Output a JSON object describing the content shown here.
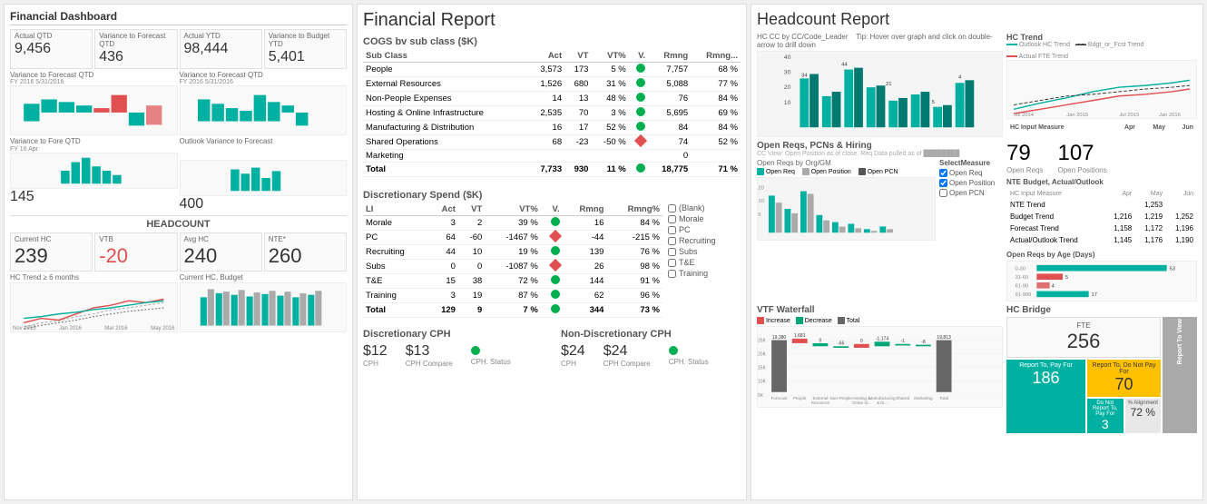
{
  "panel1": {
    "title": "Financial Dashboard",
    "kpis": [
      {
        "label": "Actual QTD",
        "value": "9,456"
      },
      {
        "label": "Variance to Forecast QTD",
        "value": "436"
      },
      {
        "label": "Actual YTD",
        "value": "98,444"
      },
      {
        "label": "Variance to Budget YTD",
        "value": "5,401"
      }
    ],
    "headcount_title": "HEADCOUNT",
    "hc_kpis": [
      {
        "label": "Current HC",
        "value": "239"
      },
      {
        "label": "VTB",
        "value": "-20"
      },
      {
        "label": "Avg HC",
        "value": "240"
      },
      {
        "label": "NTE*",
        "value": "260"
      }
    ],
    "variance_labels": [
      "Variance to Fore QTD",
      "Variance to Forecast QTD",
      "Outlook Variance to Forecast"
    ],
    "variance_values": [
      "145",
      "",
      "400"
    ]
  },
  "panel2": {
    "title": "Financial Report",
    "cogs_title": "COGS bv sub class ($K)",
    "columns": [
      "Sub Class",
      "Act",
      "VT",
      "VT%",
      "V.",
      "Rmng",
      "Rmng..."
    ],
    "rows": [
      {
        "name": "People",
        "act": "3,573",
        "vt": "173",
        "vt_pct": "5 %",
        "dot": "green",
        "rmng": "7,757",
        "rmng_pct": "68 %"
      },
      {
        "name": "External Resources",
        "act": "1,526",
        "vt": "680",
        "vt_pct": "31 %",
        "dot": "green",
        "rmng": "5,088",
        "rmng_pct": "77 %"
      },
      {
        "name": "Non-People Expenses",
        "act": "14",
        "vt": "13",
        "vt_pct": "48 %",
        "dot": "green",
        "rmng": "76",
        "rmng_pct": "84 %"
      },
      {
        "name": "Hosting & Online Infrastructure",
        "act": "2,535",
        "vt": "70",
        "vt_pct": "3 %",
        "dot": "green",
        "rmng": "5,695",
        "rmng_pct": "69 %"
      },
      {
        "name": "Manufacturing & Distribution",
        "act": "16",
        "vt": "17",
        "vt_pct": "52 %",
        "dot": "green",
        "rmng": "84",
        "rmng_pct": "84 %"
      },
      {
        "name": "Shared Operations",
        "act": "68",
        "vt": "-23",
        "vt_pct": "-50 %",
        "dot": "diamond",
        "rmng": "74",
        "rmng_pct": "52 %"
      },
      {
        "name": "Marketing",
        "act": "",
        "vt": "",
        "vt_pct": "",
        "dot": "",
        "rmng": "0",
        "rmng_pct": ""
      }
    ],
    "total_row": {
      "name": "Total",
      "act": "7,733",
      "vt": "930",
      "vt_pct": "11 %",
      "dot": "green",
      "rmng": "18,775",
      "rmng_pct": "71 %"
    },
    "disc_title": "Discretionary Spend ($K)",
    "disc_columns": [
      "LI",
      "Act",
      "VT",
      "VT%",
      "V.",
      "Rmng",
      "Rmng%"
    ],
    "disc_rows": [
      {
        "name": "Morale",
        "act": "3",
        "vt": "2",
        "vt_pct": "39 %",
        "dot": "green",
        "rmng": "16",
        "rmng_pct": "84 %"
      },
      {
        "name": "PC",
        "act": "64",
        "vt": "-60",
        "vt_pct": "-1467 %",
        "dot": "diamond",
        "rmng": "-44",
        "rmng_pct": "-215 %"
      },
      {
        "name": "Recruiting",
        "act": "44",
        "vt": "10",
        "vt_pct": "19 %",
        "dot": "green",
        "rmng": "139",
        "rmng_pct": "76 %"
      },
      {
        "name": "Subs",
        "act": "0",
        "vt": "0",
        "vt_pct": "-1087 %",
        "dot": "diamond",
        "rmng": "26",
        "rmng_pct": "98 %"
      },
      {
        "name": "T&E",
        "act": "15",
        "vt": "38",
        "vt_pct": "72 %",
        "dot": "green",
        "rmng": "144",
        "rmng_pct": "91 %"
      },
      {
        "name": "Training",
        "act": "3",
        "vt": "19",
        "vt_pct": "87 %",
        "dot": "green",
        "rmng": "62",
        "rmng_pct": "96 %"
      }
    ],
    "disc_total": {
      "name": "Total",
      "act": "129",
      "vt": "9",
      "vt_pct": "7 %",
      "dot": "green",
      "rmng": "344",
      "rmng_pct": "73 %"
    },
    "disc_cph_title": "Discretionary CPH",
    "disc_cph": "$12",
    "disc_cph_compare": "$13",
    "disc_cph_label": "CPH",
    "disc_cph_compare_label": "CPH Compare",
    "disc_cph_status_label": "CPH. Status",
    "nondisc_cph_title": "Non-Discretionary CPH",
    "nondisc_cph": "$24",
    "nondisc_cph_compare": "$24",
    "nondisc_cph_label": "CPH",
    "nondisc_cph_compare_label": "CPH Compare",
    "nondisc_cph_status_label": "CPH. Status",
    "checkbox_items": [
      "(Blank)",
      "Morale",
      "PC",
      "Recruiting",
      "Subs",
      "T&E",
      "Training"
    ]
  },
  "panel3": {
    "title": "Headcount Report",
    "open_reqs_title": "Open Reqs, PCNs & Hiring",
    "open_reqs_num": "79",
    "open_reqs_label": "Open Reqs",
    "open_pos_num": "107",
    "open_pos_label": "Open Positions",
    "vtf_title": "VTF Waterfall",
    "vtf_values": {
      "forecast": "19,380",
      "total": "19,813"
    },
    "hc_bridge_title": "HC Bridge",
    "fte_label": "FTE",
    "fte_value": "256",
    "report_to_pay": "186",
    "do_not_report_to_pay": "70",
    "report_to_pay2": "3",
    "pct_alignment": "72 %",
    "legend": [
      {
        "color": "#e05050",
        "label": "Increase"
      },
      {
        "color": "#00a878",
        "label": "Decrease"
      },
      {
        "color": "#666",
        "label": "Total"
      }
    ],
    "hc_trend_title": "HC Trend",
    "hc_trend_legend": [
      "Outlook HC Trend",
      "Bdgt_or_Fcst Trend",
      "Actual FTE Trend"
    ],
    "nte_table": {
      "headers": [
        "HC Input Measure",
        "Apr",
        "May",
        "Jun"
      ],
      "rows": [
        {
          "label": "NTE Trend",
          "apr": "",
          "may": "1,253",
          "jun": ""
        },
        {
          "label": "Budget Trend",
          "apr": "1,216",
          "may": "1,219",
          "jun": "1,252"
        },
        {
          "label": "Forecast Trend",
          "apr": "1,158",
          "may": "1,172",
          "jun": "1,196"
        },
        {
          "label": "Actual/Outlook Trend",
          "apr": "1,145",
          "may": "1,176",
          "jun": "1,190"
        }
      ]
    }
  }
}
